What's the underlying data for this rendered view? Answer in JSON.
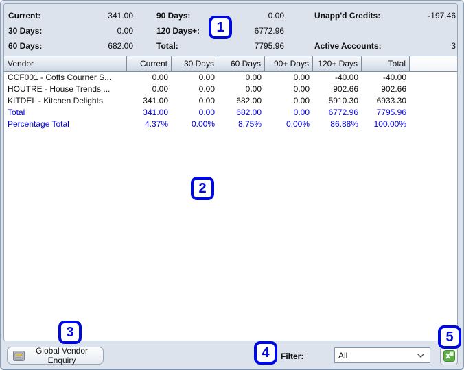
{
  "summary": {
    "current_label": "Current:",
    "current_value": "341.00",
    "days30_label": "30 Days:",
    "days30_value": "0.00",
    "days60_label": "60 Days:",
    "days60_value": "682.00",
    "days90_label": "90 Days:",
    "days90_value": "0.00",
    "days120_label": "120 Days+:",
    "days120_value": "6772.96",
    "total_label": "Total:",
    "total_value": "7795.96",
    "unappd_credits_label": "Unapp'd Credits:",
    "unappd_credits_value": "-197.46",
    "active_accounts_label": "Active Accounts:",
    "active_accounts_value": "3"
  },
  "table": {
    "columns": [
      "Vendor",
      "Current",
      "30 Days",
      "60 Days",
      "90+ Days",
      "120+ Days",
      "Total"
    ],
    "rows": [
      {
        "cells": [
          "CCF001 - Coffs Courner S...",
          "0.00",
          "0.00",
          "0.00",
          "0.00",
          "-40.00",
          "-40.00"
        ],
        "emphasis": "normal"
      },
      {
        "cells": [
          "HOUTRE - House Trends ...",
          "0.00",
          "0.00",
          "0.00",
          "0.00",
          "902.66",
          "902.66"
        ],
        "emphasis": "normal"
      },
      {
        "cells": [
          "KITDEL - Kitchen Delights",
          "341.00",
          "0.00",
          "682.00",
          "0.00",
          "5910.30",
          "6933.30"
        ],
        "emphasis": "normal"
      },
      {
        "cells": [
          "Total",
          "341.00",
          "0.00",
          "682.00",
          "0.00",
          "6772.96",
          "7795.96"
        ],
        "emphasis": "blue"
      },
      {
        "cells": [
          "Percentage Total",
          "4.37%",
          "0.00%",
          "8.75%",
          "0.00%",
          "86.88%",
          "100.00%"
        ],
        "emphasis": "blue"
      }
    ]
  },
  "annotations": [
    "1",
    "2",
    "3",
    "4",
    "5"
  ],
  "footer": {
    "global_vendor_button_label": "Global Vendor Enquiry",
    "cash_register_icon": "cash-register-icon",
    "filter_label": "Filter:",
    "filter_selected_value": "All",
    "chevron_icon": "chevron-down-icon",
    "export_excel_icon": "excel-export-icon"
  },
  "colors": {
    "annotation_blue": "#0009dd",
    "total_row_blue": "#0000e6",
    "panel_bg": "#dce3ed",
    "header_gradient_bottom": "#c9d4e2",
    "excel_green": "#5fae47"
  }
}
